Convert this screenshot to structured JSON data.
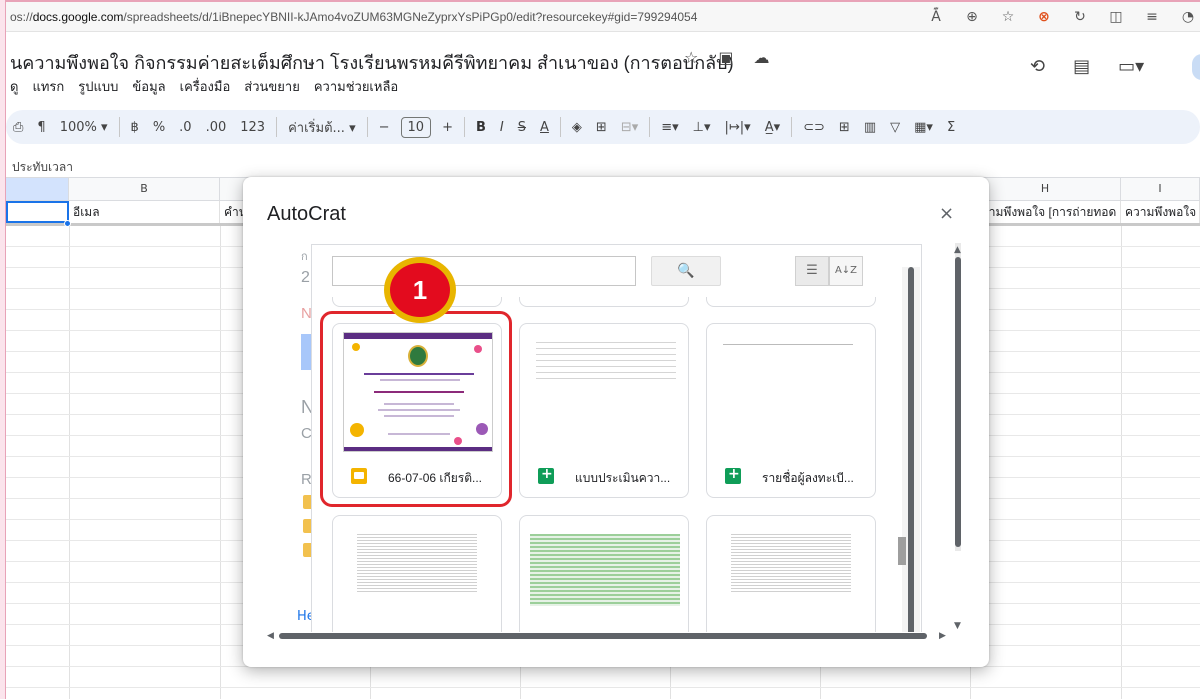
{
  "browser": {
    "url_prefix": "os://",
    "url_domain": "docs.google.com",
    "url_path": "/spreadsheets/d/1iBnepecYBNII-kJAmo4voZUM63MGNeZyprxYsPiPGp0/edit?resourcekey#gid=799294054",
    "icons": [
      "read-aloud-icon",
      "zoom-icon",
      "favorite-star-icon",
      "extension-icon",
      "refresh-icon",
      "split-screen-icon",
      "favorites-list-icon",
      "profile-icon"
    ]
  },
  "document": {
    "title": "นความพึงพอใจ กิจกรรมค่ายสะเต็มศึกษา โรงเรียนพรหมคีรีพิทยาคม สำเนาของ (การตอบกลับ)",
    "menu": [
      "ดู",
      "แทรก",
      "รูปแบบ",
      "ข้อมูล",
      "เครื่องมือ",
      "ส่วนขยาย",
      "ความช่วยเหลือ"
    ]
  },
  "toolbar": {
    "zoom": "100%",
    "currency": "฿",
    "percent": "%",
    "dec_decrease": ".0",
    "dec_increase": ".00",
    "number_format": "123",
    "font": "ค่าเริ่มต้...",
    "font_size": "10",
    "minus": "−",
    "plus": "+"
  },
  "formula_bar": {
    "cell_content": "ประทับเวลา"
  },
  "sheet": {
    "columns": [
      "",
      "B",
      "",
      "",
      "",
      "",
      "",
      "H",
      "I"
    ],
    "row1": [
      "",
      "อีเมล",
      "คำน",
      "",
      "",
      "",
      "",
      "ความพึงพอใจ [การถ่ายทอด",
      "ความพึงพอใจ"
    ]
  },
  "dialog": {
    "title": "AutoCrat",
    "close": "×",
    "behind_text": [
      "ก",
      "2",
      "N",
      "N",
      "C",
      "R",
      "He"
    ]
  },
  "picker": {
    "search_placeholder": "",
    "sort_label": "A↓Z",
    "files": [
      {
        "name": "66-07-06 เกียรติ...",
        "type": "slides"
      },
      {
        "name": "แบบประเมินควา...",
        "type": "sheets"
      },
      {
        "name": "รายชื่อผู้ลงทะเบี...",
        "type": "sheets"
      }
    ]
  },
  "annotation": {
    "step_number": "1"
  },
  "colors": {
    "highlight": "#e0262c",
    "badge_outer": "#e8b500",
    "badge_inner": "#e30b1e",
    "sheets_green": "#0f9d58",
    "slides_yellow": "#f4b400"
  }
}
